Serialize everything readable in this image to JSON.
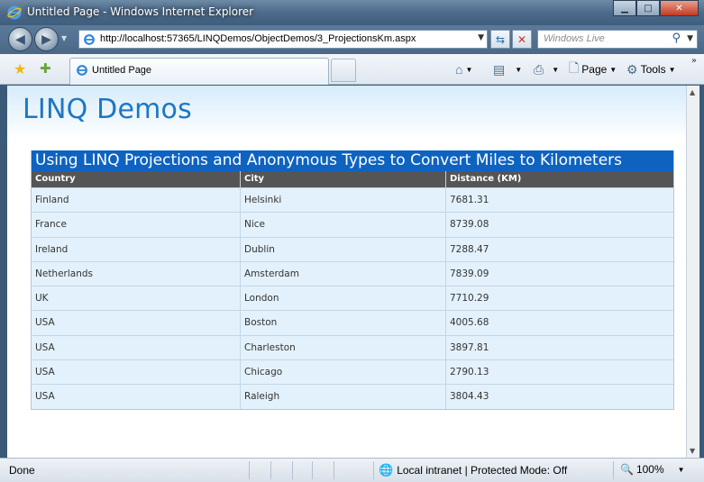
{
  "window": {
    "title": "Untitled Page - Windows Internet Explorer",
    "min_glyph": "▁",
    "max_glyph": "□",
    "close_glyph": "✕"
  },
  "address_bar": {
    "url": "http://localhost:57365/LINQDemos/ObjectDemos/3_ProjectionsKm.aspx",
    "search_placeholder": "Windows Live"
  },
  "tabs": [
    {
      "label": "Untitled Page"
    }
  ],
  "toolbar": {
    "page_label": "Page",
    "tools_label": "Tools"
  },
  "page": {
    "site_title": "LINQ Demos",
    "grid": {
      "caption": "Using LINQ Projections and Anonymous Types to Convert Miles to Kilometers",
      "columns": [
        "Country",
        "City",
        "Distance (KM)"
      ],
      "rows": [
        [
          "Finland",
          "Helsinki",
          "7681.31"
        ],
        [
          "France",
          "Nice",
          "8739.08"
        ],
        [
          "Ireland",
          "Dublin",
          "7288.47"
        ],
        [
          "Netherlands",
          "Amsterdam",
          "7839.09"
        ],
        [
          "UK",
          "London",
          "7710.29"
        ],
        [
          "USA",
          "Boston",
          "4005.68"
        ],
        [
          "USA",
          "Charleston",
          "3897.81"
        ],
        [
          "USA",
          "Chicago",
          "2790.13"
        ],
        [
          "USA",
          "Raleigh",
          "3804.43"
        ]
      ]
    }
  },
  "status_bar": {
    "status": "Done",
    "zone": "Local intranet | Protected Mode: Off",
    "zoom": "100%"
  },
  "colors": {
    "title_blue": "#1d76c6",
    "caption_bg": "#0e63c1",
    "header_bg": "#555555",
    "row_bg": "#e3f1fc"
  }
}
